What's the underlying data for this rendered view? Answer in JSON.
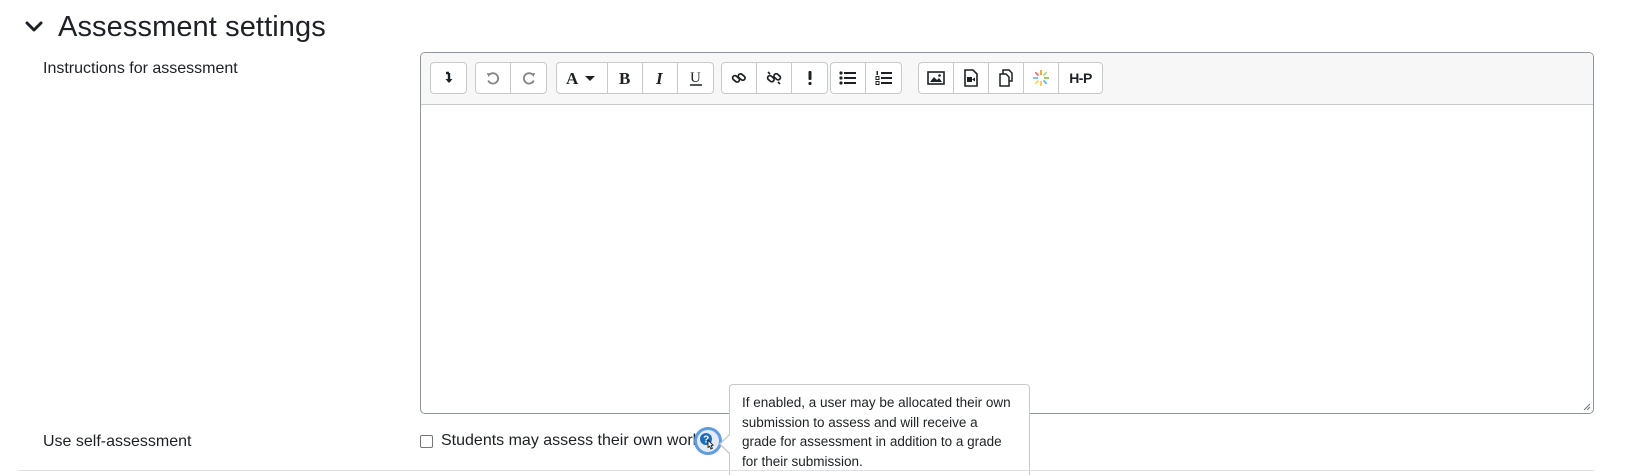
{
  "section": {
    "title": "Assessment settings",
    "toggle_icon": "chevron-down-icon"
  },
  "instructions": {
    "label": "Instructions for assessment",
    "content": ""
  },
  "toolbar": {
    "groups": [
      [
        "collapse-icon"
      ],
      [
        "undo-icon",
        "redo-icon"
      ],
      [
        "font-style-dropdown-icon",
        "bold-icon",
        "italic-icon",
        "underline-icon"
      ],
      [
        "link-icon",
        "unlink-icon",
        "accessibility-checker-icon"
      ],
      [
        "bullet-list-icon",
        "numbered-list-icon"
      ],
      [
        "insert-image-icon",
        "insert-media-icon",
        "manage-files-icon",
        "recording-icon",
        "h5p-icon"
      ]
    ],
    "h5p_text": "H-P"
  },
  "self_assessment": {
    "label": "Use self-assessment",
    "checkbox_label": "Students may assess their own work",
    "checked": false,
    "help_icon": "help-question-icon",
    "tooltip_lines": [
      "If enabled, a user may be allocated their own",
      "submission to assess and will receive a",
      "grade for assessment in addition to a grade",
      "for their submission."
    ]
  },
  "colors": {
    "text": "#1d2125",
    "border": "#8f959e",
    "toolbar_bg": "#f7f7f7",
    "help_focus": "#5f9ce0"
  }
}
